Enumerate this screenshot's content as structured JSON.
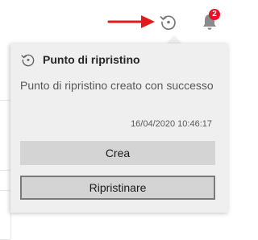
{
  "topbar": {
    "restore_icon": "restore-clock-icon",
    "notifications_icon": "bell-icon",
    "notification_count": "2",
    "annotation_arrow_color": "#e11b1b"
  },
  "popup": {
    "title": "Punto di ripristino",
    "message": "Punto di ripristino creato con successo",
    "timestamp": "16/04/2020 10:46:17",
    "create_label": "Crea",
    "restore_label": "Ripristinare"
  },
  "colors": {
    "badge": "#e81123",
    "popup_bg": "#efefef",
    "button_bg": "#d4d4d4"
  }
}
